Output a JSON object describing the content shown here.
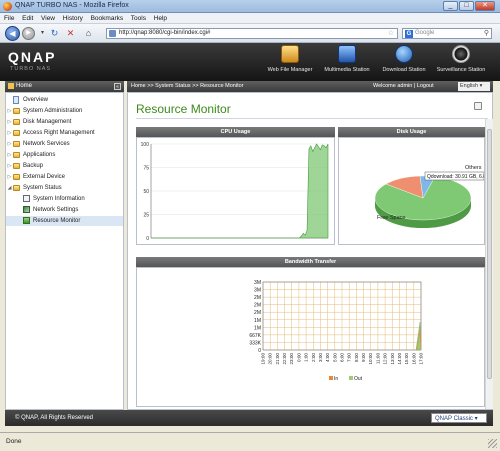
{
  "window": {
    "title": "QNAP TURBO NAS - Mozilla Firefox"
  },
  "menu": [
    "File",
    "Edit",
    "View",
    "History",
    "Bookmarks",
    "Tools",
    "Help"
  ],
  "nav": {
    "url": "http://qnap:8080/cgi-bin/index.cgi#",
    "search_placeholder": "Google"
  },
  "brand": {
    "logo": "QNAP",
    "sub": "TURBO NAS"
  },
  "banner_items": [
    {
      "label": "Web File Manager",
      "icon": "web-file-manager-icon"
    },
    {
      "label": "Multimedia Station",
      "icon": "multimedia-station-icon"
    },
    {
      "label": "Download Station",
      "icon": "download-station-icon"
    },
    {
      "label": "Surveillance Station",
      "icon": "surveillance-station-icon"
    }
  ],
  "sidebar": {
    "title": "Home",
    "items": [
      {
        "label": "Overview",
        "type": "page"
      },
      {
        "label": "System Administration",
        "type": "folder"
      },
      {
        "label": "Disk Management",
        "type": "folder"
      },
      {
        "label": "Access Right Management",
        "type": "folder"
      },
      {
        "label": "Network Services",
        "type": "folder"
      },
      {
        "label": "Applications",
        "type": "folder"
      },
      {
        "label": "Backup",
        "type": "folder"
      },
      {
        "label": "External Device",
        "type": "folder"
      },
      {
        "label": "System Status",
        "type": "folder-open"
      },
      {
        "label": "System Information",
        "type": "child"
      },
      {
        "label": "Network Settings",
        "type": "child"
      },
      {
        "label": "Resource Monitor",
        "type": "child",
        "selected": true
      }
    ]
  },
  "header": {
    "breadcrumb": "Home >> System Status >> Resource Monitor",
    "welcome": "Welcome admin | Logout",
    "language": "English"
  },
  "page": {
    "title": "Resource Monitor",
    "cpu_title": "CPU Usage",
    "disk_title": "Disk Usage",
    "bandwidth_title": "Bandwidth Transfer"
  },
  "chart_data": [
    {
      "type": "area",
      "title": "CPU Usage",
      "ylim": [
        0,
        100
      ],
      "y_ticks": [
        0,
        25,
        50,
        75,
        100
      ],
      "values": [
        0,
        0,
        0,
        0,
        0,
        0,
        0,
        0,
        0,
        0,
        0,
        0,
        0,
        0,
        0,
        0,
        0,
        0,
        0,
        0,
        0,
        0,
        0,
        0,
        0,
        0,
        0,
        0,
        0,
        0,
        0,
        0,
        0,
        0,
        0,
        0,
        0,
        0,
        0,
        0,
        0,
        0,
        0,
        0,
        0,
        0,
        0,
        0,
        0,
        0,
        0,
        0,
        0,
        0,
        0,
        0,
        0,
        0,
        0,
        0,
        0,
        0,
        0,
        0,
        0,
        0,
        0,
        0,
        0,
        0,
        0,
        0,
        0,
        0,
        0,
        0,
        0,
        0,
        0,
        2,
        5,
        3,
        8,
        95,
        98,
        92,
        96,
        100,
        97,
        94,
        99,
        98,
        96,
        100
      ],
      "color": "#7fc874"
    },
    {
      "type": "pie",
      "title": "Disk Usage",
      "slices": [
        {
          "label": "Free Space",
          "value": 82,
          "color": "#7fc874"
        },
        {
          "label": "Others",
          "value": 13,
          "color": "#ef8f6f"
        },
        {
          "label": "Qdownload",
          "value": 5,
          "color": "#7fb7e6"
        }
      ],
      "tooltip": "Qdownload: 30.91 GB, 6.85%"
    },
    {
      "type": "area",
      "title": "Bandwidth Transfer",
      "y_ticks": [
        "0",
        "333K",
        "667K",
        "1M",
        "1M",
        "2M",
        "2M",
        "2M",
        "3M",
        "3M"
      ],
      "categories": [
        "19:00",
        "20:00",
        "21:00",
        "22:00",
        "23:00",
        "0:00",
        "1:00",
        "2:00",
        "3:00",
        "4:00",
        "5:00",
        "6:00",
        "7:00",
        "8:00",
        "9:00",
        "10:00",
        "11:00",
        "12:00",
        "13:00",
        "14:00",
        "15:00",
        "16:00",
        "17:00"
      ],
      "series": [
        {
          "name": "In",
          "color": "#e8893a"
        },
        {
          "name": "Out",
          "color": "#9ccb7a"
        }
      ]
    }
  ],
  "footer": {
    "copyright": "© QNAP, All Rights Reserved",
    "theme": "QNAP Classic"
  },
  "status": {
    "text": "Done"
  }
}
